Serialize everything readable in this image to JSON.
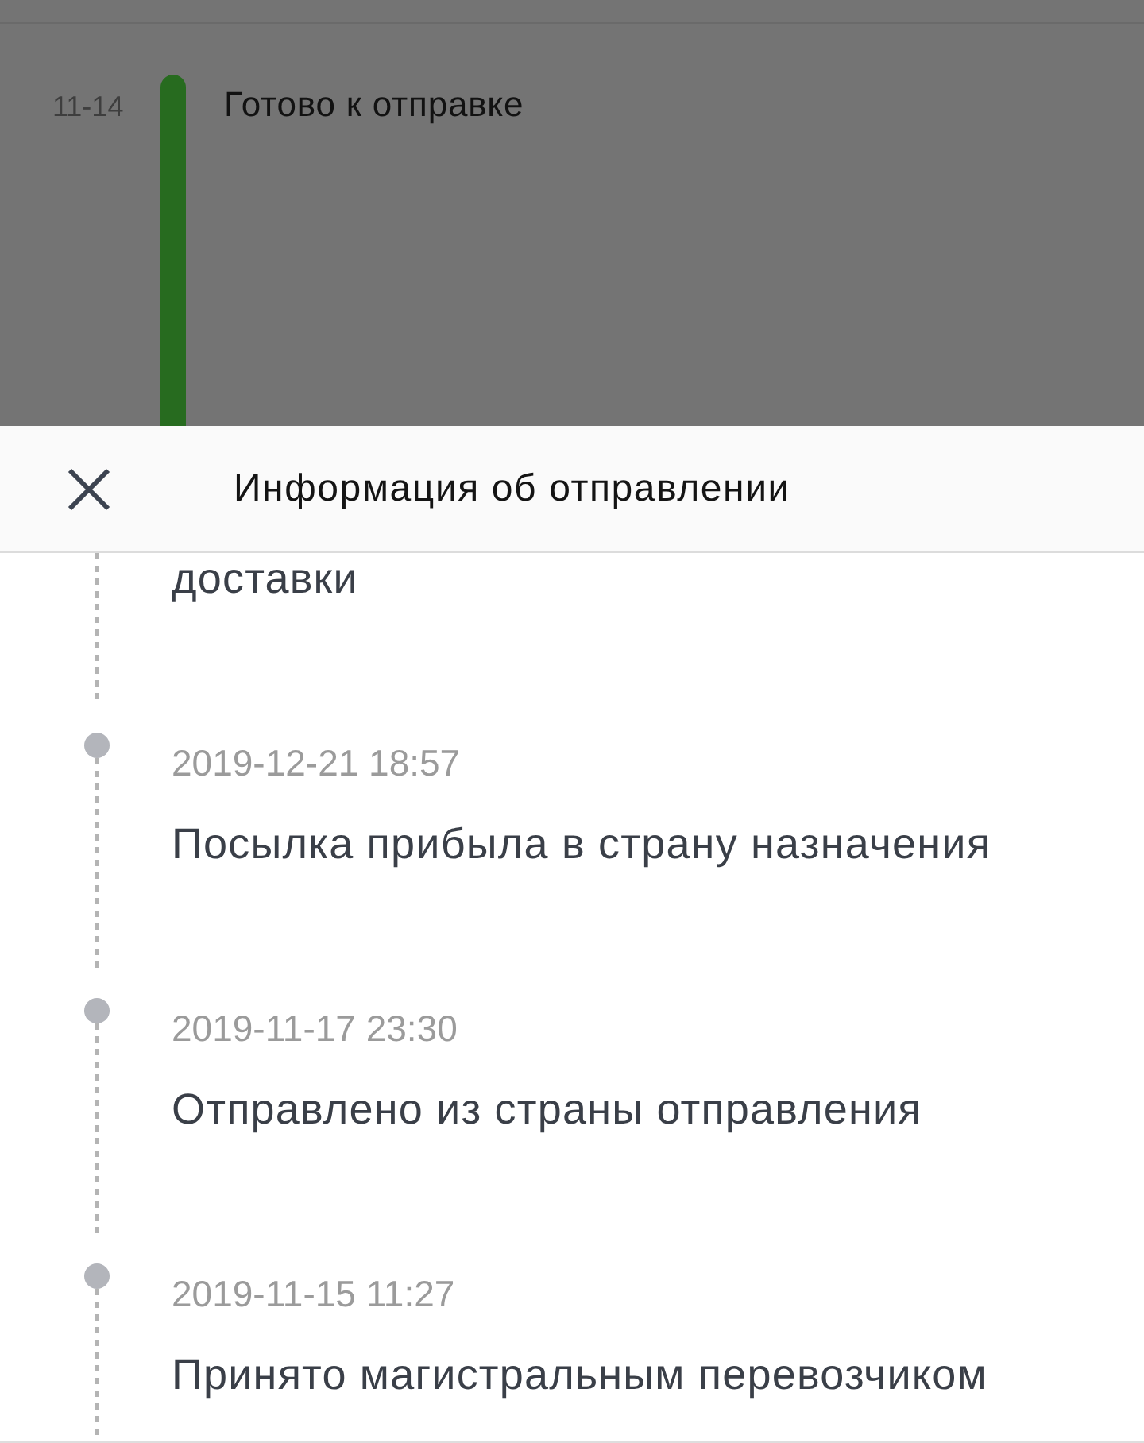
{
  "background": {
    "date": "11-14",
    "status": "Готово к отправке"
  },
  "sheet": {
    "title": "Информация об отправлении",
    "events": [
      {
        "kind": "continued",
        "text": "доставки"
      },
      {
        "kind": "event",
        "date": "2019-12-21 18:57",
        "text": "Посылка прибыла в страну назначения"
      },
      {
        "kind": "event",
        "date": "2019-11-17 23:30",
        "text": "Отправлено из страны отправления"
      },
      {
        "kind": "event",
        "date": "2019-11-15 11:27",
        "text": "Принято магистральным перевозчиком"
      }
    ]
  }
}
